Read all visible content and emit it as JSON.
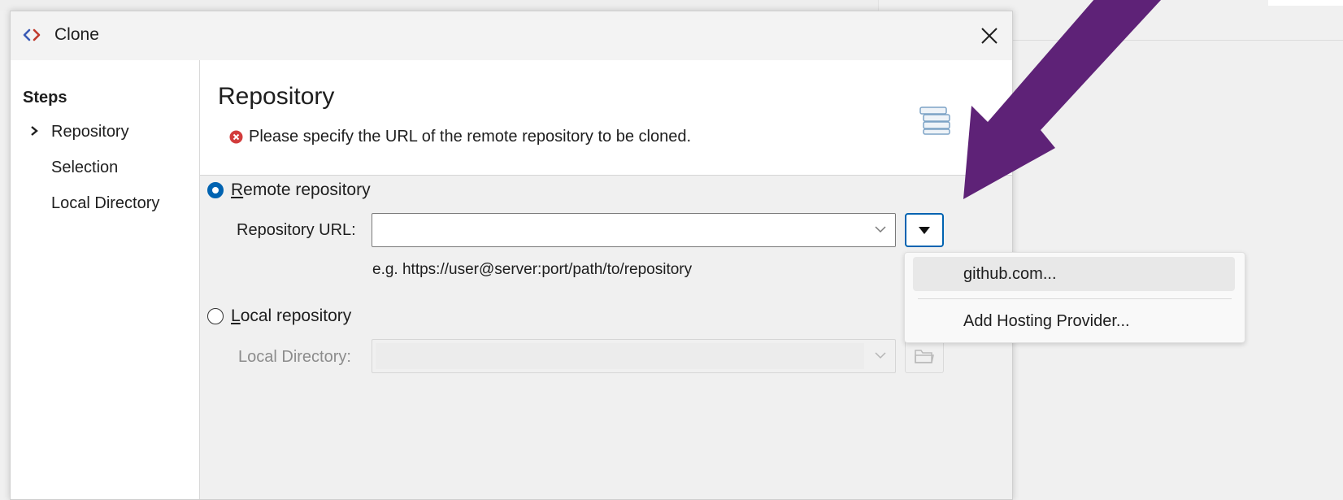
{
  "dialog": {
    "title": "Clone",
    "close_symbol": "✕"
  },
  "steps": {
    "heading": "Steps",
    "items": [
      {
        "label": "Repository",
        "current": true
      },
      {
        "label": "Selection",
        "current": false
      },
      {
        "label": "Local Directory",
        "current": false
      }
    ]
  },
  "page": {
    "title": "Repository",
    "error_message": "Please specify the URL of the remote repository to be cloned."
  },
  "remote": {
    "mnemonic": "R",
    "label_rest": "emote repository",
    "selected": true,
    "url_label": "Repository URL:",
    "url_value": "",
    "hint": "e.g. https://user@server:port/path/to/repository"
  },
  "local": {
    "mnemonic": "L",
    "label_rest": "ocal repository",
    "selected": false,
    "dir_label": "Local Directory:",
    "dir_value": ""
  },
  "dropdown_menu": {
    "items": [
      "github.com...",
      "Add Hosting Provider..."
    ]
  },
  "colors": {
    "accent": "#0063b1",
    "error": "#d23c3c",
    "annotation_arrow": "#5e2277"
  }
}
